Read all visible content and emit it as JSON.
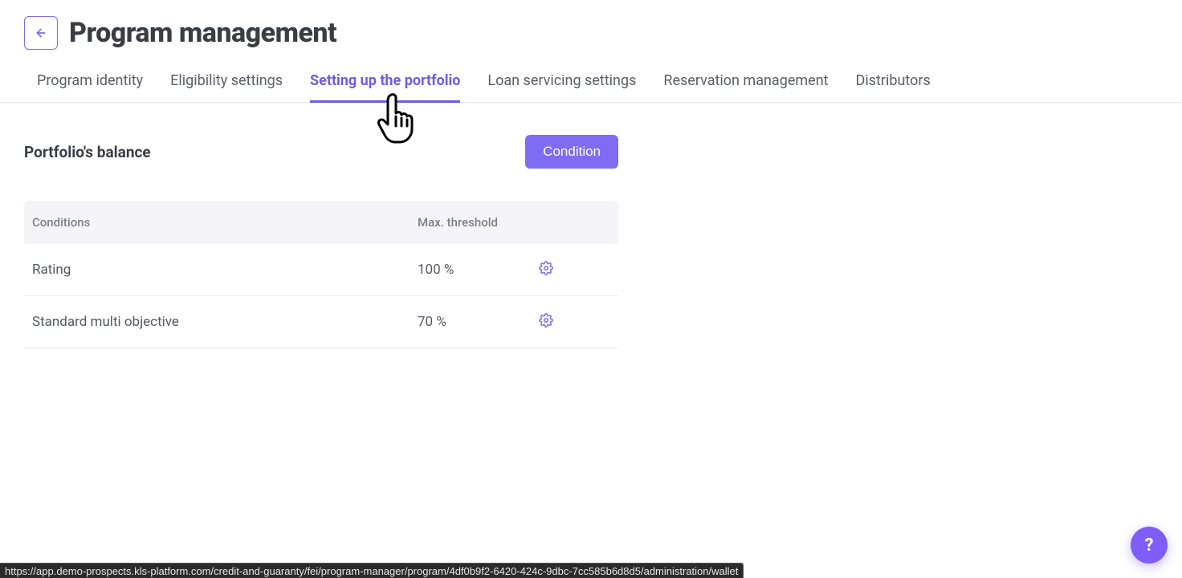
{
  "header": {
    "title": "Program management"
  },
  "tabs": [
    {
      "label": "Program identity",
      "active": false
    },
    {
      "label": "Eligibility settings",
      "active": false
    },
    {
      "label": "Setting up the portfolio",
      "active": true
    },
    {
      "label": "Loan servicing settings",
      "active": false
    },
    {
      "label": "Reservation management",
      "active": false
    },
    {
      "label": "Distributors",
      "active": false
    }
  ],
  "section": {
    "title": "Portfolio's balance",
    "condition_btn": "Condition"
  },
  "table": {
    "columns": {
      "conditions": "Conditions",
      "threshold": "Max. threshold"
    },
    "rows": [
      {
        "condition": "Rating",
        "threshold": "100 %"
      },
      {
        "condition": "Standard multi objective",
        "threshold": "70 %"
      }
    ]
  },
  "help": {
    "label": "?"
  },
  "status_url": "https://app.demo-prospects.kls-platform.com/credit-and-guaranty/fei/program-manager/program/4df0b9f2-6420-424c-9dbc-7cc585b6d8d5/administration/wallet"
}
